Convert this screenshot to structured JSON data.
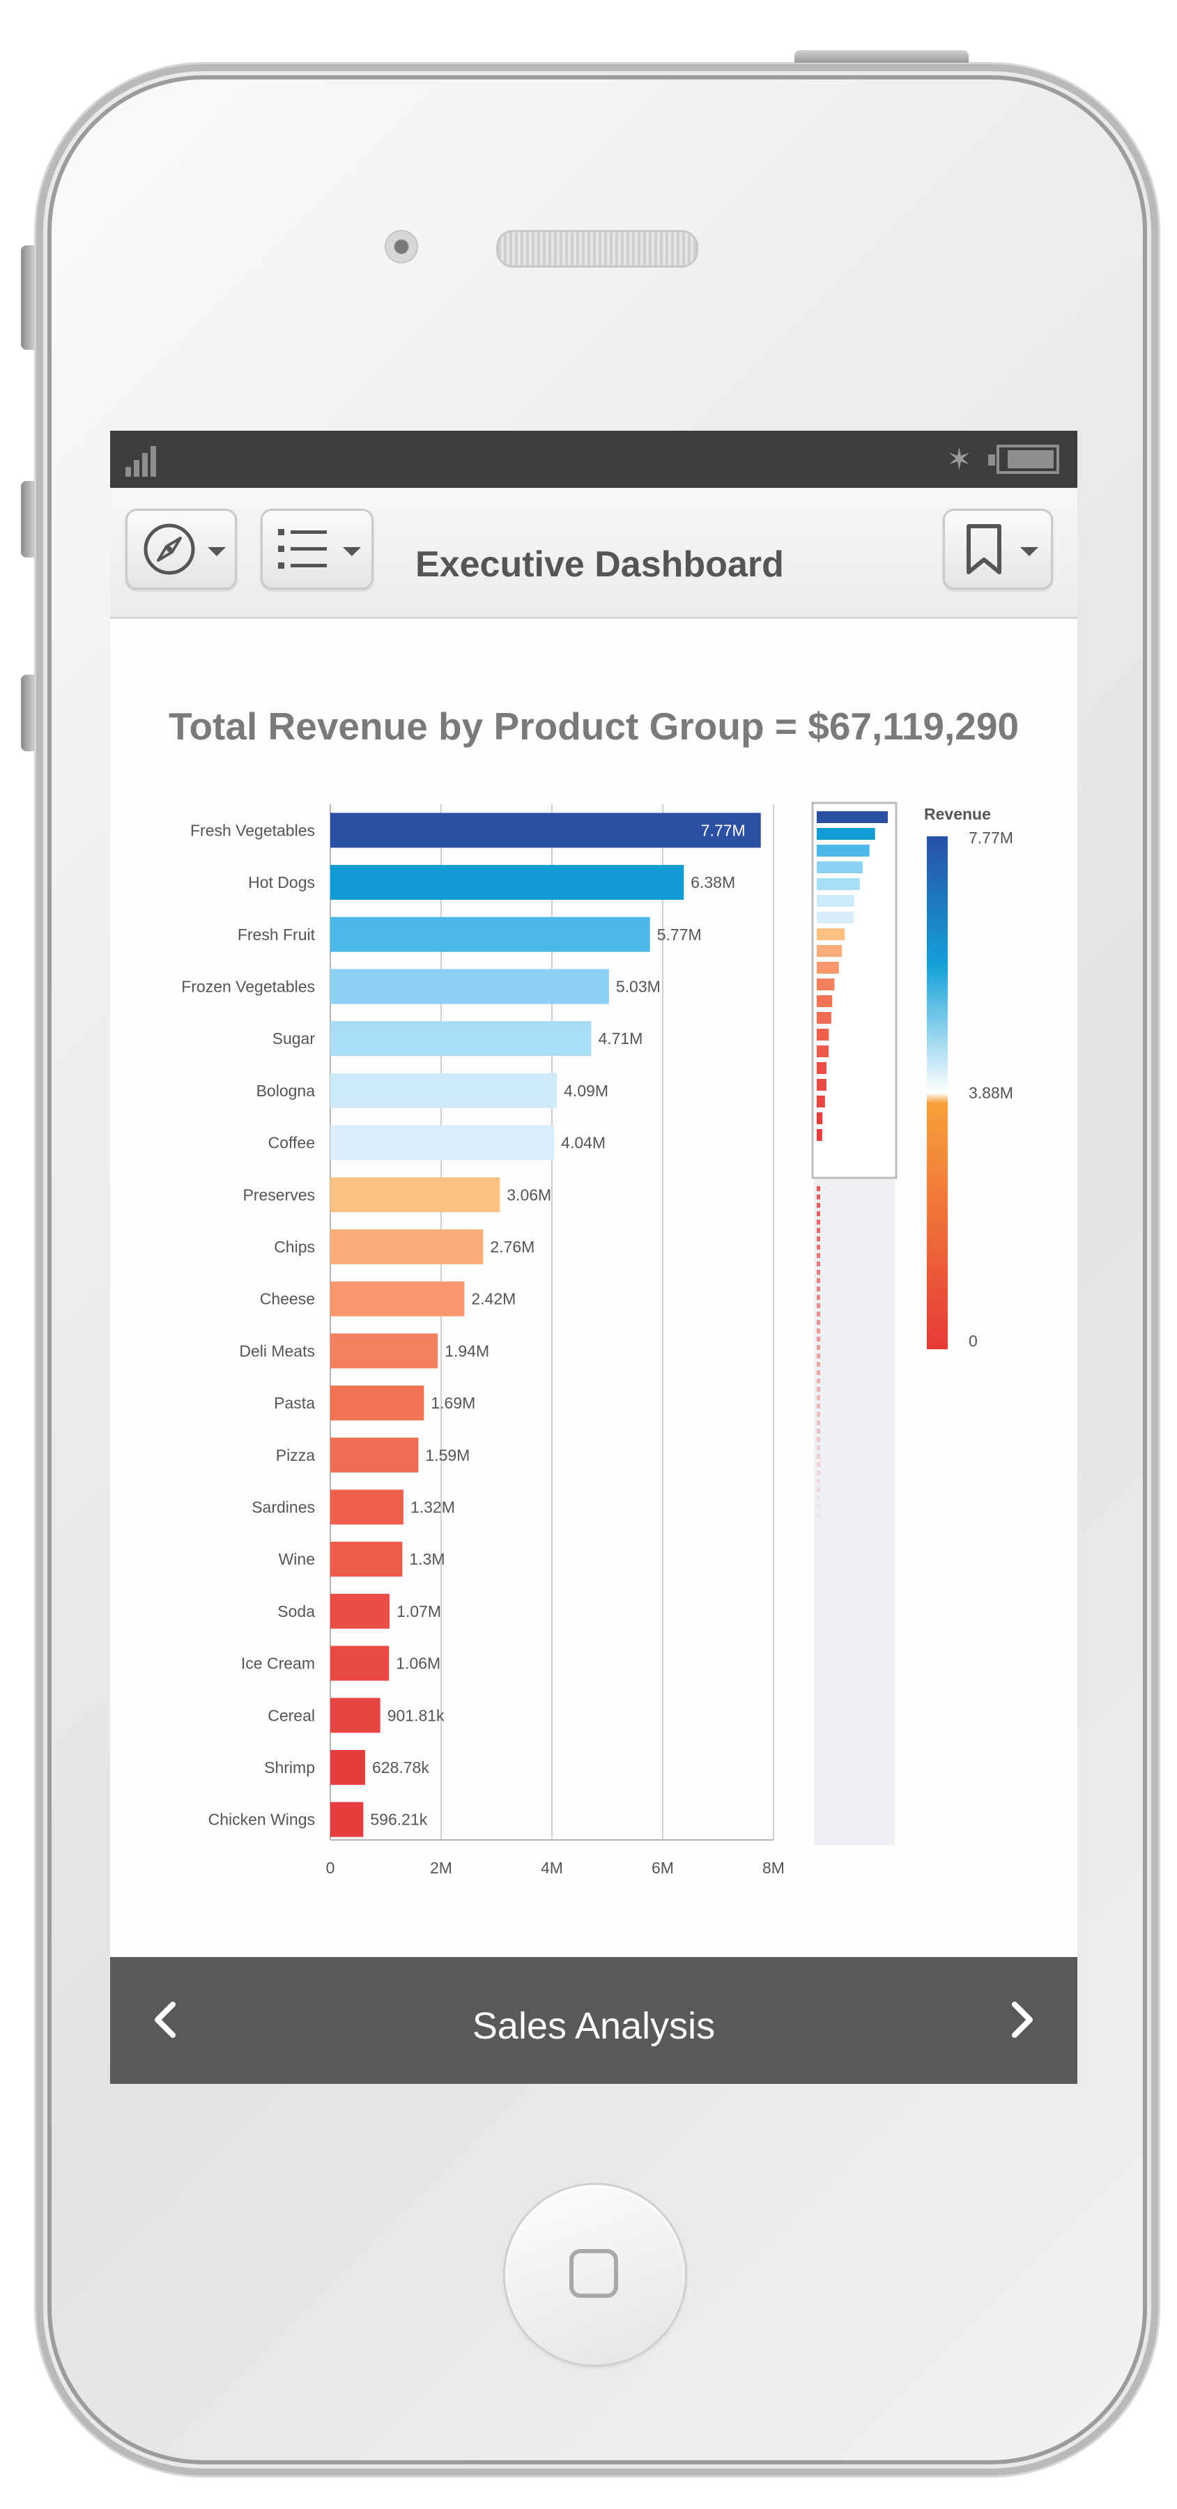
{
  "statusbar": {
    "bluetooth_icon": "bluetooth-icon",
    "battery_icon": "battery-icon",
    "signal_icon": "signal-icon"
  },
  "toolbar": {
    "title": "Executive Dashboard",
    "nav_icon": "compass-icon",
    "list_icon": "list-icon",
    "bookmark_icon": "bookmark-icon"
  },
  "chart_data": {
    "type": "bar",
    "orientation": "horizontal",
    "title": "Total Revenue by Product Group = $67,119,290",
    "categories": [
      "Fresh Vegetables",
      "Hot Dogs",
      "Fresh Fruit",
      "Frozen Vegetables",
      "Sugar",
      "Bologna",
      "Coffee",
      "Preserves",
      "Chips",
      "Cheese",
      "Deli Meats",
      "Pasta",
      "Pizza",
      "Sardines",
      "Wine",
      "Soda",
      "Ice Cream",
      "Cereal",
      "Shrimp",
      "Chicken Wings"
    ],
    "values": [
      7770000,
      6380000,
      5770000,
      5030000,
      4710000,
      4090000,
      4040000,
      3060000,
      2760000,
      2420000,
      1940000,
      1690000,
      1590000,
      1320000,
      1300000,
      1070000,
      1060000,
      901810,
      628780,
      596210
    ],
    "data_labels": [
      "7.77M",
      "6.38M",
      "5.77M",
      "5.03M",
      "4.71M",
      "4.09M",
      "4.04M",
      "3.06M",
      "2.76M",
      "2.42M",
      "1.94M",
      "1.69M",
      "1.59M",
      "1.32M",
      "1.3M",
      "1.07M",
      "1.06M",
      "901.81k",
      "628.78k",
      "596.21k"
    ],
    "x_ticks": [
      "0",
      "2M",
      "4M",
      "6M",
      "8M"
    ],
    "xlim": [
      0,
      8000000
    ],
    "grid": true,
    "legend": {
      "title": "Revenue",
      "labels": [
        "7.77M",
        "3.88M",
        "0"
      ],
      "placement": "right",
      "colors": [
        "#2850a6",
        "#14a0d8",
        "#ffffff",
        "#f5921e",
        "#e63a38"
      ]
    },
    "bar_colors": [
      "#2b4fa3",
      "#119cd6",
      "#4bb8e8",
      "#8ed2f3",
      "#a8ddf6",
      "#cdeaf9",
      "#d9eefa",
      "#fcc081",
      "#f9ad78",
      "#f7976b",
      "#f47f5f",
      "#f37455",
      "#f06c52",
      "#ee5f4c",
      "#ec5a49",
      "#ea4e46",
      "#e94a44",
      "#e84442",
      "#e63e3f",
      "#e63c3e"
    ],
    "has_overview_minimap": true
  },
  "footer": {
    "title": "Sales Analysis",
    "prev_icon": "chevron-left-icon",
    "next_icon": "chevron-right-icon"
  }
}
